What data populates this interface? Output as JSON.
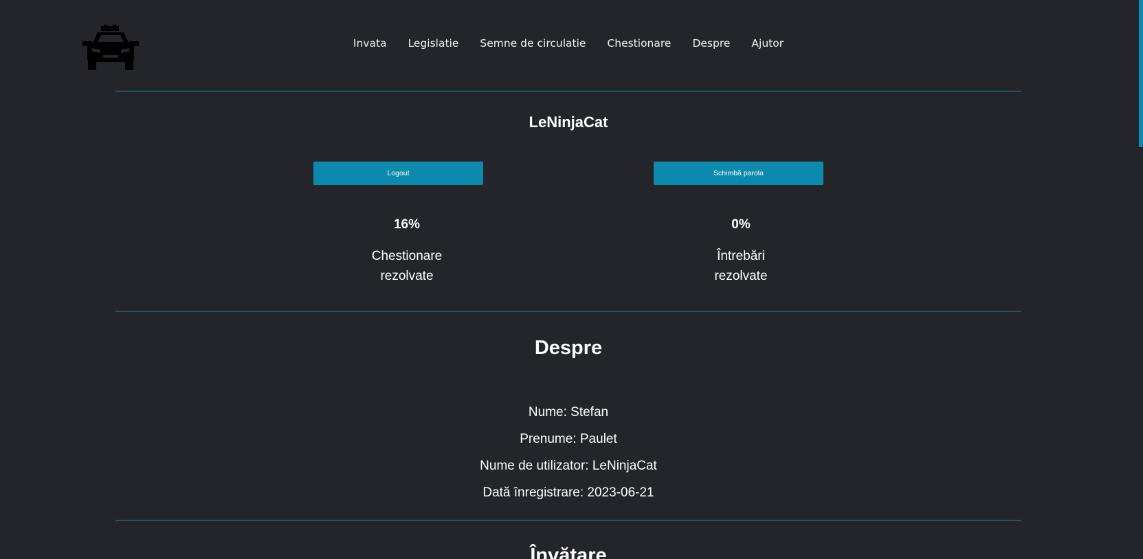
{
  "header": {
    "logo_icon": "taxi-car-icon",
    "nav": [
      {
        "label": "Invata"
      },
      {
        "label": "Legislatie"
      },
      {
        "label": "Semne de circulatie"
      },
      {
        "label": "Chestionare"
      },
      {
        "label": "Despre"
      },
      {
        "label": "Ajutor"
      }
    ]
  },
  "profile": {
    "username": "LeNinjaCat",
    "logout_label": "Logout",
    "change_password_label": "Schimbă parola",
    "stats": [
      {
        "value": "16%",
        "label_line1": "Chestionare",
        "label_line2": "rezolvate"
      },
      {
        "value": "0%",
        "label_line1": "Întrebări",
        "label_line2": "rezolvate"
      }
    ]
  },
  "about": {
    "title": "Despre",
    "lines": [
      "Nume: Stefan",
      "Prenume: Paulet",
      "Nume de utilizator: LeNinjaCat",
      "Dată înregistrare: 2023-06-21"
    ]
  },
  "learning": {
    "title": "Învățare"
  },
  "colors": {
    "background": "#23252b",
    "accent": "#0d89ad",
    "text": "#ffffff"
  }
}
